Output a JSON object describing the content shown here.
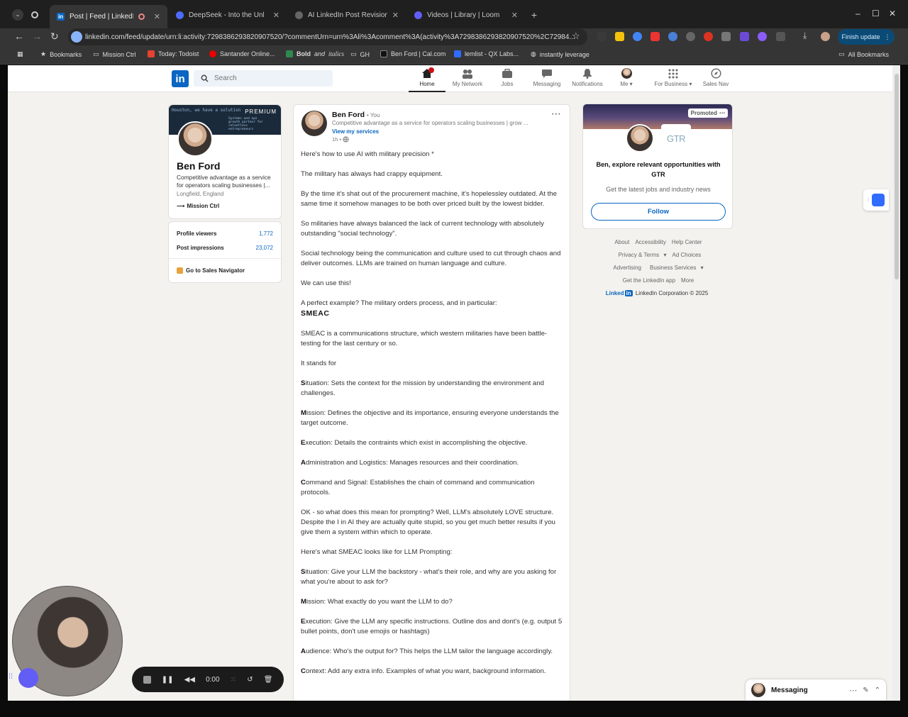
{
  "browser": {
    "tabs": [
      {
        "title": "Post | Feed | LinkedIn",
        "active": true,
        "favicon": "in"
      },
      {
        "title": "DeepSeek - Into the Unknown",
        "active": false
      },
      {
        "title": "AI LinkedIn Post Revision",
        "active": false
      },
      {
        "title": "Videos | Library | Loom",
        "active": false
      }
    ],
    "url": "linkedin.com/feed/update/urn:li:activity:7298386293820907520/?commentUrn=urn%3Ali%3Acomment%3A(activity%3A7298386293820907520%2C72984...",
    "finish_update": "Finish update",
    "bookmarks": [
      "Bookmarks",
      "Mission Ctrl",
      "Today: Todoist",
      "Santander Online...",
      "GH",
      "Ben Ford | Cal.com",
      "lemlist - QX Labs...",
      "instantly leverage",
      "All Bookmarks"
    ],
    "bookmark_bold_italic": [
      "Bold",
      "and",
      "italics"
    ]
  },
  "linkedin": {
    "search_placeholder": "Search",
    "nav": [
      {
        "label": "Home",
        "icon": "home-icon"
      },
      {
        "label": "My Network",
        "icon": "network-icon"
      },
      {
        "label": "Jobs",
        "icon": "briefcase-icon"
      },
      {
        "label": "Messaging",
        "icon": "messaging-icon"
      },
      {
        "label": "Notifications",
        "icon": "bell-icon"
      },
      {
        "label": "Me",
        "icon": "avatar"
      },
      {
        "label": "For Business",
        "icon": "grid-icon"
      },
      {
        "label": "Sales Nav",
        "icon": "compass-icon"
      }
    ]
  },
  "profile": {
    "cover_text": "Houston, we have a solution",
    "cover_caption": "Systems and ops growth partner for relentless entrepreneurs",
    "premium": "PREMIUM",
    "name": "Ben Ford",
    "headline": "Competitive advantage as a service for operators scaling businesses |...",
    "location": "Longfield, England",
    "company": "Mission Ctrl",
    "stats": [
      {
        "label": "Profile viewers",
        "value": "1,772"
      },
      {
        "label": "Post impressions",
        "value": "23,072"
      }
    ],
    "sales_nav": "Go to Sales Navigator"
  },
  "post": {
    "author": "Ben Ford",
    "you": "• You",
    "headline": "Competitive advantage as a service for operators scaling businesses | grow ...",
    "view_services": "View my services",
    "time": "1h •",
    "paragraphs": [
      "Here's how to use AI with military precision *",
      "The military has always had crappy equipment.",
      "By the time it's shat out of the procurement machine, it's hopelessley outdated. At the same time it somehow manages to be both over priced built by the lowest bidder.",
      "So militaries have always balanced the lack of current technology with absolutely outstanding \"social technology\".",
      "Social technology being the communication and culture used to cut through chaos and deliver outcomes. LLMs are trained on human language and culture.",
      "We can use this!"
    ],
    "smeac_intro": "A perfect example? The military orders process, and in particular:",
    "smeac_title": "SMEAC",
    "paragraphs2": [
      "SMEAC is a communications structure, which western militaries have been battle-testing for the last century or so.",
      "It stands for"
    ],
    "items": [
      {
        "letter": "S",
        "rest": "ituation: Sets the context for the mission by understanding the environment and challenges."
      },
      {
        "letter": "M",
        "rest": "ission: Defines the objective and its importance, ensuring everyone understands the target outcome."
      },
      {
        "letter": "E",
        "rest": "xecution: Details the contraints which exist in accomplishing the objective."
      },
      {
        "letter": "A",
        "rest": "dministration and Logistics: Manages resources and their coordination."
      },
      {
        "letter": "C",
        "rest": "ommand and Signal: Establishes the chain of command and communication protocols."
      }
    ],
    "paragraphs3": [
      "OK - so what does this mean for prompting? Well, LLM's absolutely LOVE structure. Despite the I in AI they are actually quite stupid, so you get much better results if you give them a system within which to operate.",
      "Here's what SMEAC looks like for LLM Prompting:"
    ],
    "items2": [
      {
        "letter": "S",
        "rest": "ituation: Give your LLM the backstory - what's their role, and why are you asking for what you're about to ask for?"
      },
      {
        "letter": "M",
        "rest": "ission: What exactly do you want the LLM to do?"
      },
      {
        "letter": "E",
        "rest": "xecution: Give the LLM any specific instructions. Outline dos and dont's (e.g. output 5 bullet points, don't use emojis or hashtags)"
      },
      {
        "letter": "A",
        "rest": "udience: Who's the output for? This helps the LLM tailor the language accordingly."
      },
      {
        "letter": "C",
        "rest": "ontext: Add any extra info. Examples of what you want, background information."
      }
    ]
  },
  "ad": {
    "promoted": "Promoted",
    "company_logo": "GTR",
    "title": "Ben, explore relevant opportunities with GTR",
    "subtitle": "Get the latest jobs and industry news",
    "follow": "Follow"
  },
  "footer": {
    "row1": [
      "About",
      "Accessibility",
      "Help Center"
    ],
    "row2": [
      "Privacy & Terms",
      "Ad Choices"
    ],
    "row3": [
      "Advertising",
      "Business Services"
    ],
    "row4": [
      "Get the LinkedIn app",
      "More"
    ],
    "brand": "Linked",
    "brand_in": "in",
    "copyright": "LinkedIn Corporation © 2025"
  },
  "messaging": {
    "label": "Messaging"
  },
  "loom": {
    "time": "0:00"
  },
  "colors": {
    "linkedin_blue": "#0a66c2",
    "badge_red": "#cc1016"
  }
}
